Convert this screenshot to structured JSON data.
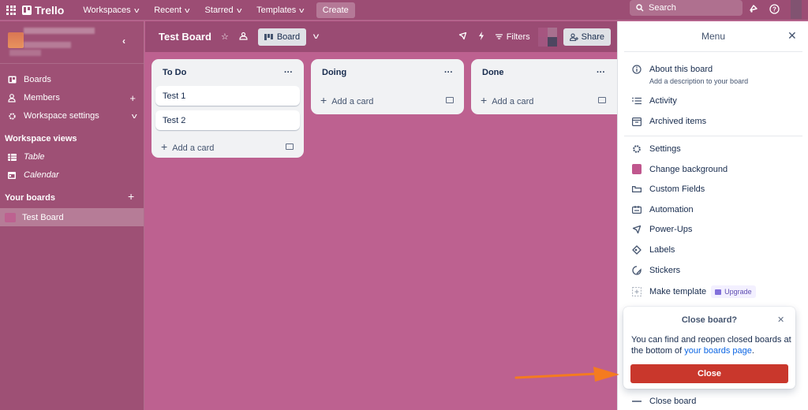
{
  "topnav": {
    "logo": "Trello",
    "items": [
      {
        "label": "Workspaces"
      },
      {
        "label": "Recent"
      },
      {
        "label": "Starred"
      },
      {
        "label": "Templates"
      }
    ],
    "create_label": "Create",
    "search_placeholder": "Search"
  },
  "sidebar": {
    "main_items": [
      {
        "label": "Boards",
        "icon": "board-icon"
      },
      {
        "label": "Members",
        "icon": "person-icon"
      },
      {
        "label": "Workspace settings",
        "icon": "gear-icon"
      }
    ],
    "views_heading": "Workspace views",
    "views": [
      {
        "label": "Table",
        "icon": "table-icon"
      },
      {
        "label": "Calendar",
        "icon": "calendar-icon"
      }
    ],
    "boards_heading": "Your boards",
    "boards": [
      {
        "label": "Test Board",
        "color": "#bd6190"
      }
    ]
  },
  "board": {
    "title": "Test Board",
    "view_label": "Board",
    "filters_label": "Filters",
    "share_label": "Share",
    "lists": [
      {
        "title": "To Do",
        "cards": [
          "Test 1",
          "Test 2"
        ],
        "add_label": "Add a card"
      },
      {
        "title": "Doing",
        "cards": [],
        "add_label": "Add a card"
      },
      {
        "title": "Done",
        "cards": [],
        "add_label": "Add a card"
      }
    ]
  },
  "menu": {
    "title": "Menu",
    "about": {
      "label": "About this board",
      "sub": "Add a description to your board"
    },
    "items_group1": [
      {
        "label": "Activity"
      },
      {
        "label": "Archived items"
      }
    ],
    "items_group2": [
      {
        "label": "Settings"
      },
      {
        "label": "Change background",
        "color": "#c0578e"
      },
      {
        "label": "Custom Fields"
      },
      {
        "label": "Automation"
      },
      {
        "label": "Power-Ups"
      },
      {
        "label": "Labels"
      },
      {
        "label": "Stickers"
      },
      {
        "label": "Make template",
        "badge": "Upgrade"
      }
    ],
    "close_board_label": "Close board"
  },
  "popover": {
    "title": "Close board?",
    "text_before": "You can find and reopen closed boards at the bottom of ",
    "link": "your boards page",
    "text_after": ".",
    "button_label": "Close",
    "button_color": "#c9372c"
  },
  "annotation": {
    "arrow_color": "#f47b20"
  }
}
